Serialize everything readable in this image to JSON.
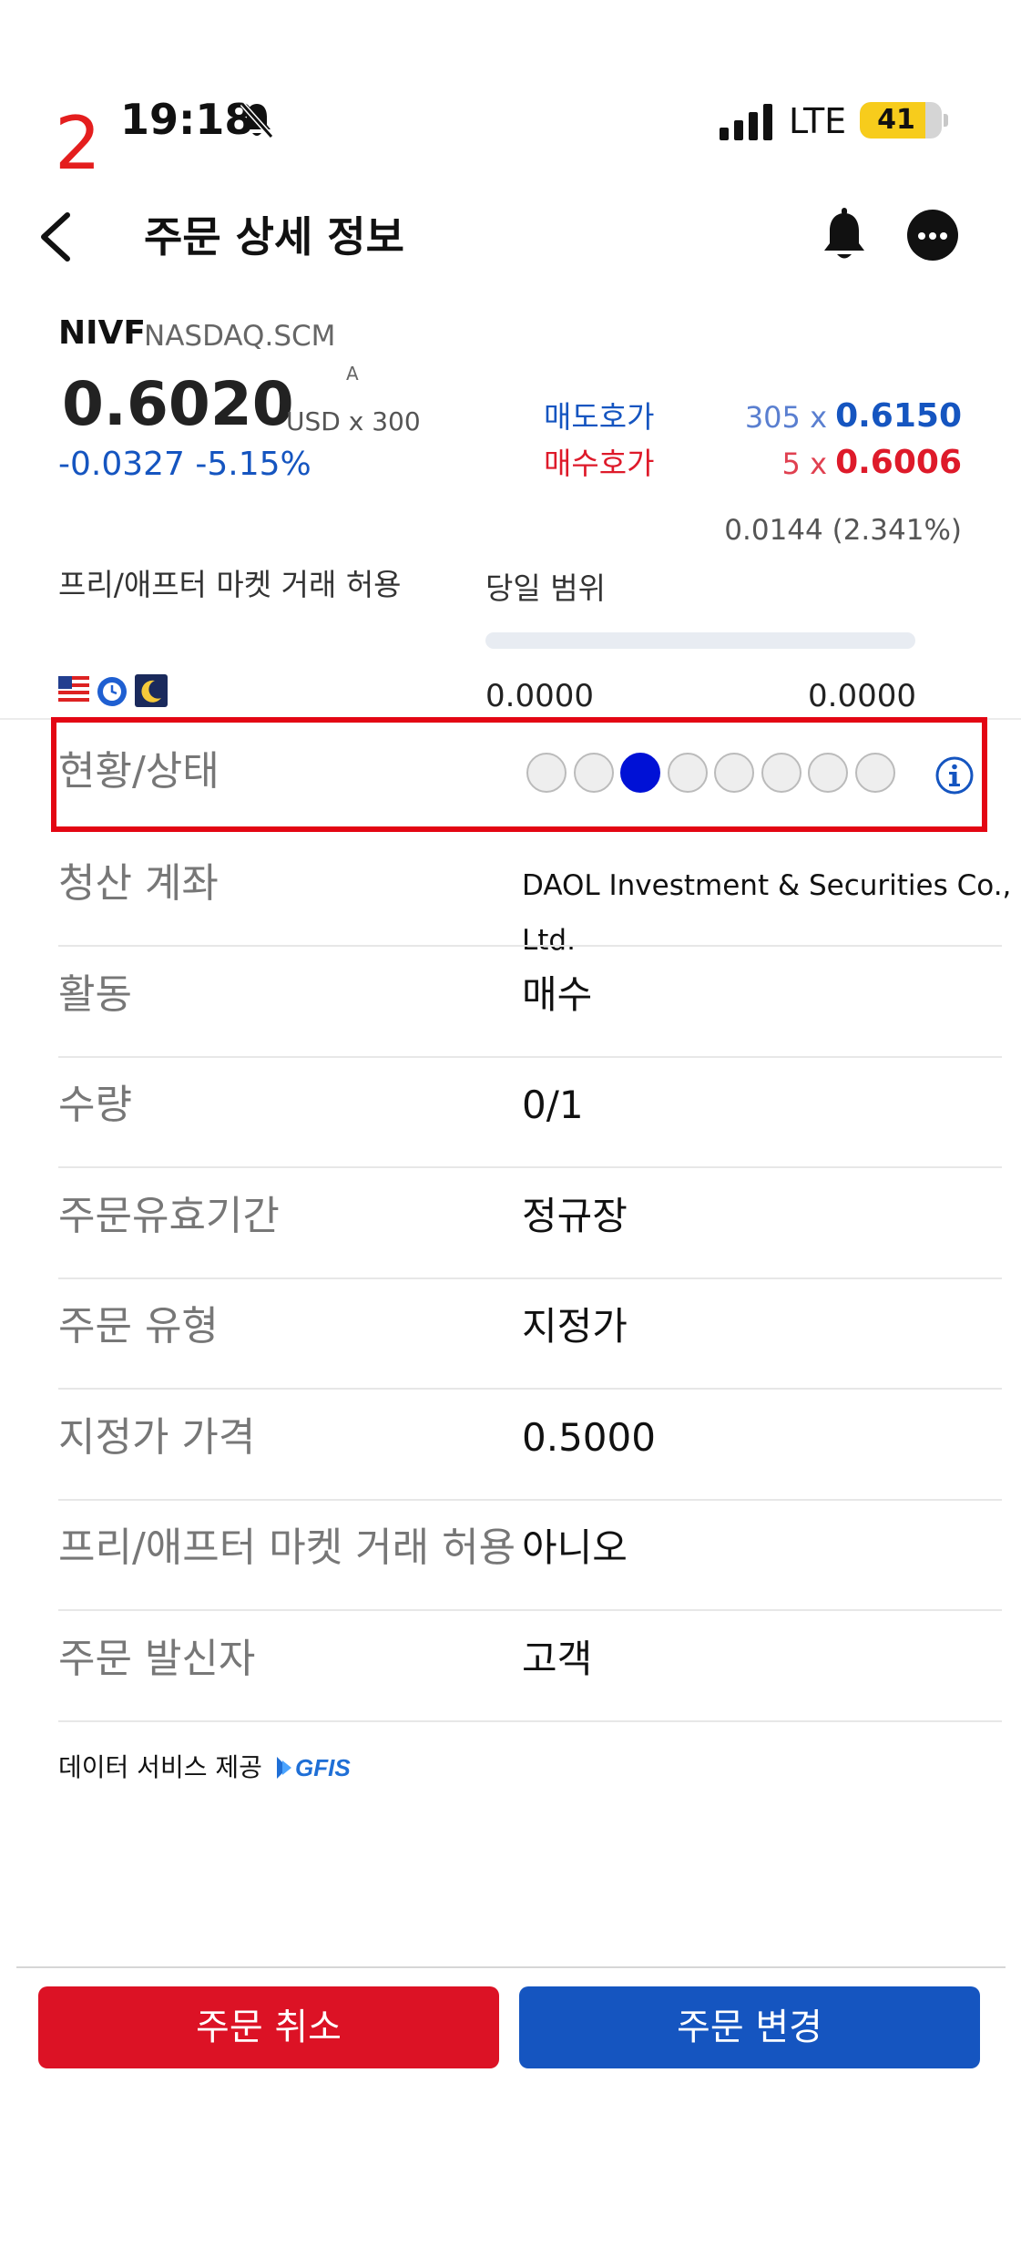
{
  "status_bar": {
    "step": "2",
    "time": "19:18",
    "network": "LTE",
    "battery": "41"
  },
  "header": {
    "title": "주문 상세 정보"
  },
  "stock": {
    "ticker": "NIVF",
    "exchange": "NASDAQ.SCM",
    "price": "0.6020",
    "price_superscript": "A",
    "currency_lot": "USD x 300",
    "change": "-0.0327  -5.15%",
    "ask_label": "매도호가",
    "ask_size": "305 x",
    "ask_price": "0.6150",
    "bid_label": "매수호가",
    "bid_size": "5 x",
    "bid_price": "0.6006",
    "range_diff": "0.0144 (2.341%)",
    "prepost_label": "프리/애프터 마켓 거래 허용",
    "day_range_label": "당일 범위",
    "range_low": "0.0000",
    "range_high": "0.0000"
  },
  "status_row": {
    "label": "현황/상태",
    "steps_total": 8,
    "active_step": 3
  },
  "details": [
    {
      "label": "청산 계좌",
      "value": "DAOL Investment & Securities Co., Ltd."
    },
    {
      "label": "활동",
      "value": "매수"
    },
    {
      "label": "수량",
      "value": "0/1"
    },
    {
      "label": "주문유효기간",
      "value": "정규장"
    },
    {
      "label": "주문 유형",
      "value": "지정가"
    },
    {
      "label": "지정가 가격",
      "value": "0.5000"
    },
    {
      "label": "프리/애프터 마켓 거래 허용",
      "value": "아니오"
    },
    {
      "label": "주문 발신자",
      "value": "고객"
    }
  ],
  "footer": {
    "credit": "데이터 서비스 제공",
    "logo_text": "GFIS",
    "cancel_label": "주문 취소",
    "modify_label": "주문 변경"
  },
  "colors": {
    "highlight": "#e30613",
    "ask": "#1555c0",
    "bid": "#de1a2a",
    "active_dot": "#0011d6"
  }
}
